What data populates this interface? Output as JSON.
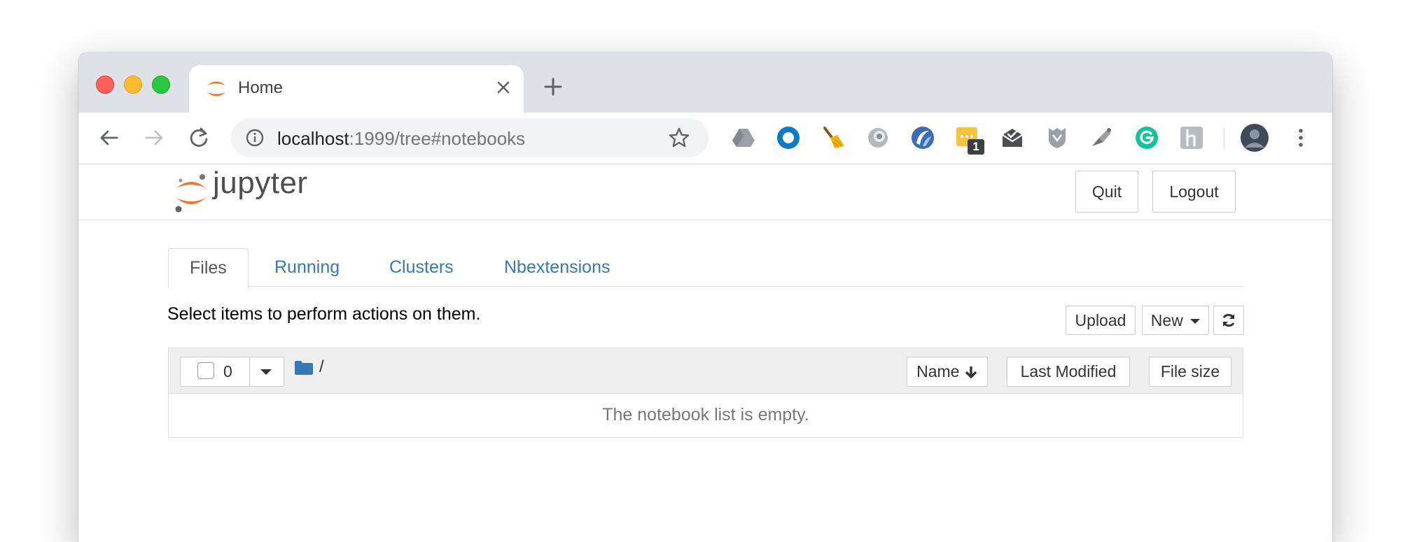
{
  "browser": {
    "tab": {
      "title": "Home"
    },
    "url": {
      "host": "localhost",
      "rest": ":1999/tree#notebooks"
    },
    "extensions": [
      "google-drive-icon",
      "ring-icon",
      "broom-icon",
      "grey-circle-icon",
      "blue-swirl-icon",
      "chat-badge-icon",
      "mail-check-icon",
      "shield-icon",
      "satellite-icon",
      "grammarly-icon",
      "hypothesis-icon"
    ],
    "extension_badge": "1",
    "colors": {
      "tabstrip": "#dee1e6",
      "omnibox": "#f1f3f4"
    }
  },
  "jupyter": {
    "logo_text": "jupyter",
    "header_buttons": {
      "quit": "Quit",
      "logout": "Logout"
    },
    "tabs": [
      {
        "label": "Files",
        "active": true
      },
      {
        "label": "Running",
        "active": false
      },
      {
        "label": "Clusters",
        "active": false
      },
      {
        "label": "Nbextensions",
        "active": false
      }
    ],
    "hint": "Select items to perform actions on them.",
    "actions": {
      "upload": "Upload",
      "new": "New"
    },
    "list": {
      "selected_count": "0",
      "path": "/",
      "columns": {
        "name": "Name",
        "last_modified": "Last Modified",
        "file_size": "File size"
      },
      "empty_message": "The notebook list is empty."
    },
    "colors": {
      "link": "#337ab7",
      "logo_orange": "#f37626",
      "folder": "#337ab7"
    }
  }
}
